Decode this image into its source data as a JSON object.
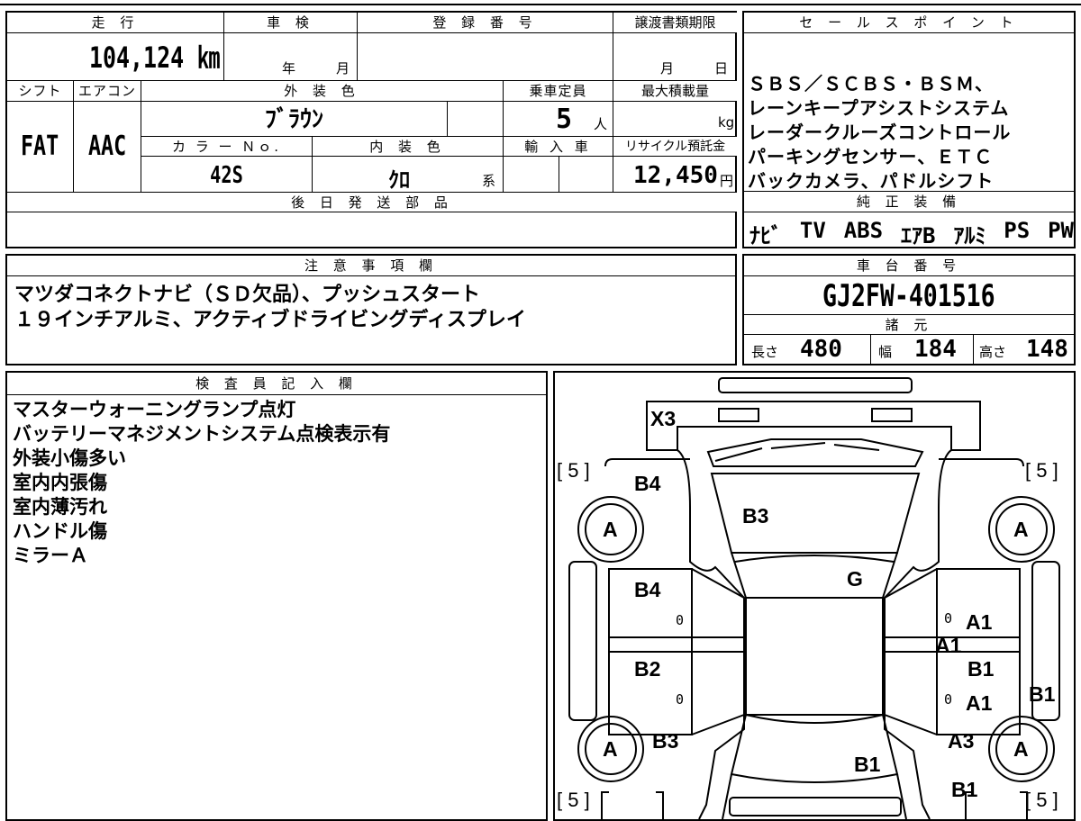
{
  "top": {
    "mileage_label": "走 行",
    "mileage": "104,124 ㎞",
    "inspection_label": "車 検",
    "year_unit": "年",
    "month_unit": "月",
    "registration_label": "登 録 番 号",
    "transfer_label": "譲渡書類期限",
    "transfer_month": "月",
    "transfer_day": "日",
    "shift_label": "シフト",
    "shift": "FAT",
    "ac_label": "エアコン",
    "ac": "AAC",
    "ext_color_label": "外 装 色",
    "ext_color": "ﾌﾞﾗｳﾝ",
    "capacity_label": "乗車定員",
    "capacity": "5",
    "capacity_unit": "人",
    "max_load_label": "最大積載量",
    "max_load_unit": "kg",
    "color_no_label": "カ ラ ー Ｎｏ.",
    "color_no": "42S",
    "int_color_label": "内 装 色",
    "int_color": "ｸﾛ",
    "int_color_suffix": "系",
    "import_label": "輸 入 車",
    "recycle_label": "リサイクル預託金",
    "recycle_amount": "12,450",
    "recycle_unit": "円",
    "later_parts_label": "後 日 発 送 部 品"
  },
  "sales": {
    "label": "セ ー ル ス ポ イ ン ト",
    "lines": [
      "ＳＢＳ／ＳＣＢＳ・ＢＳＭ、",
      "レーンキープアシストシステム",
      "レーダークルーズコントロール",
      "パーキングセンサー、ＥＴＣ",
      "バックカメラ、パドルシフト"
    ]
  },
  "equipment": {
    "label": "純 正 装 備",
    "items": [
      "ﾅﾋﾞ",
      "TV",
      "ABS",
      "ｴｱB",
      "ｱﾙﾐ",
      "PS",
      "PW"
    ]
  },
  "notes": {
    "label": "注 意 事 項 欄",
    "lines": [
      "マツダコネクトナビ（ＳＤ欠品）、プッシュスタート",
      "１９インチアルミ、アクティブドライビングディスプレイ"
    ]
  },
  "chassis": {
    "label": "車 台 番 号",
    "number": "GJ2FW-401516",
    "spec_label": "諸 元",
    "length_label": "長さ",
    "length": "480",
    "width_label": "幅",
    "width": "184",
    "height_label": "高さ",
    "height": "148"
  },
  "inspector": {
    "label": "検 査 員 記 入 欄",
    "lines": [
      "マスターウォーニングランプ点灯",
      "バッテリーマネジメントシステム点検表示有",
      "外装小傷多い",
      "室内内張傷",
      "室内薄汚れ",
      "ハンドル傷",
      "ミラーＡ"
    ]
  },
  "diagram": {
    "marks": {
      "x3": "X3",
      "b4_top": "B4",
      "b3_top": "B3",
      "tire_fl": "A",
      "tire_fr": "A",
      "tire_rl": "A",
      "tire_rr": "A",
      "g": "G",
      "b4_left": "B4",
      "a1_right_top": "A1",
      "a1_center": "A1",
      "b2_left": "B2",
      "b1_right": "B1",
      "a1_right_bottom": "A1",
      "b1_far_right": "B1",
      "b3_left": "B3",
      "a3_right": "A3",
      "b1_bottom": "B1",
      "b1_bottom_right": "B1"
    },
    "tire_depth": {
      "fl": "[ 5 ]",
      "fr": "[ 5 ]",
      "rl": "[ 5 ]",
      "rr": "[ 5 ]"
    },
    "zeros": {
      "left_front": "0",
      "left_rear": "0",
      "right_front": "0",
      "right_rear": "0"
    }
  }
}
